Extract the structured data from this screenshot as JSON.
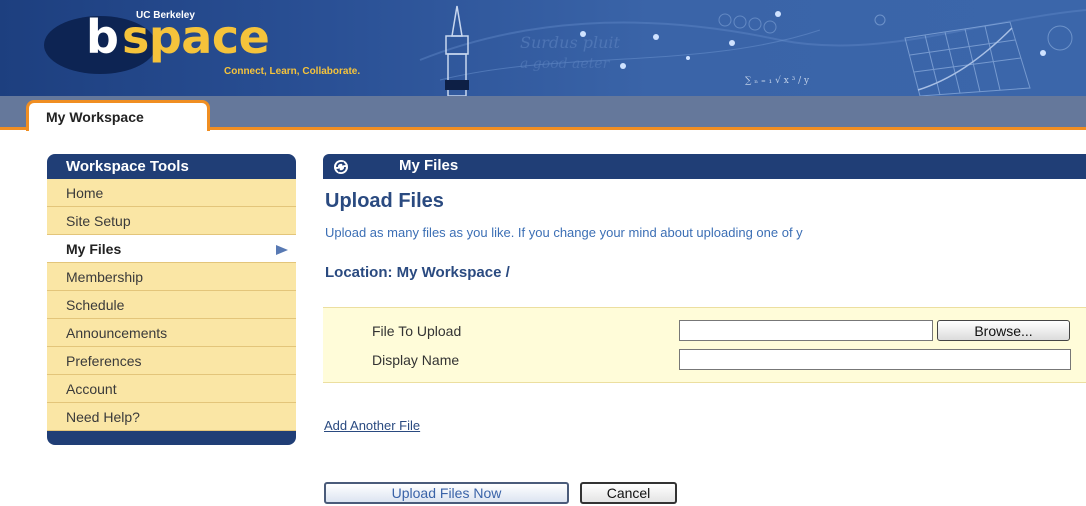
{
  "banner": {
    "university": "UC Berkeley",
    "logo_b": "b",
    "logo_space": "space",
    "tagline": "Connect, Learn, Collaborate."
  },
  "tabs": [
    {
      "label": "My Workspace",
      "selected": true
    }
  ],
  "sidebar": {
    "title": "Workspace Tools",
    "items": [
      {
        "label": "Home"
      },
      {
        "label": "Site Setup"
      },
      {
        "label": "My Files",
        "active": true
      },
      {
        "label": "Membership"
      },
      {
        "label": "Schedule"
      },
      {
        "label": "Announcements"
      },
      {
        "label": "Preferences"
      },
      {
        "label": "Account"
      },
      {
        "label": "Need Help?"
      }
    ]
  },
  "main": {
    "tool_title": "My Files",
    "page_title": "Upload Files",
    "instructions": "Upload as many files as you like. If you change your mind about uploading one of y",
    "location": "Location: My Workspace /",
    "form": {
      "file_label": "File To Upload",
      "file_value": "",
      "browse_label": "Browse...",
      "display_name_label": "Display Name",
      "display_name_value": ""
    },
    "add_another_label": "Add Another File",
    "upload_button_label": "Upload Files Now",
    "cancel_button_label": "Cancel"
  },
  "colors": {
    "banner_blue": "#2a5095",
    "nav_navy": "#203e76",
    "menu_tan": "#fae6a5",
    "tab_orange": "#f08e22",
    "tab_strip": "#65789b",
    "form_yellow": "#fffcd9",
    "heading_blue": "#2a4a80",
    "link_blue": "#3c6fb5",
    "logo_gold": "#f5c33b"
  },
  "icons": {
    "tool_reset": "reset-arrows-icon",
    "active_marker": "triangle-right-icon"
  }
}
